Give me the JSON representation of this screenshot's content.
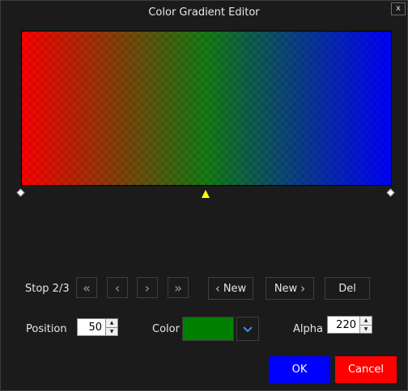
{
  "window": {
    "title": "Color Gradient Editor",
    "close_label": "x"
  },
  "gradient": {
    "colors": [
      "#ff0000",
      "#157d14",
      "#0000ff"
    ],
    "stops": [
      {
        "position": 0,
        "style": "diamond",
        "color": "#ffffff"
      },
      {
        "position": 50,
        "style": "triangle",
        "color": "#ffff00"
      },
      {
        "position": 100,
        "style": "diamond",
        "color": "#ffffff"
      }
    ]
  },
  "stop_nav": {
    "label": "Stop 2/3",
    "first_icon": "double-chevron-left",
    "prev_icon": "chevron-left",
    "next_icon": "chevron-right",
    "last_icon": "double-chevron-right",
    "new_before_label": "New",
    "new_after_label": "New",
    "delete_label": "Del"
  },
  "position": {
    "label": "Position",
    "value": "50"
  },
  "color": {
    "label": "Color",
    "swatch": "#008000",
    "dropdown_icon": "chevron-down"
  },
  "alpha": {
    "label": "Alpha",
    "value": "220"
  },
  "actions": {
    "ok_label": "OK",
    "ok_color": "#0000ff",
    "cancel_label": "Cancel",
    "cancel_color": "#ff0000"
  }
}
